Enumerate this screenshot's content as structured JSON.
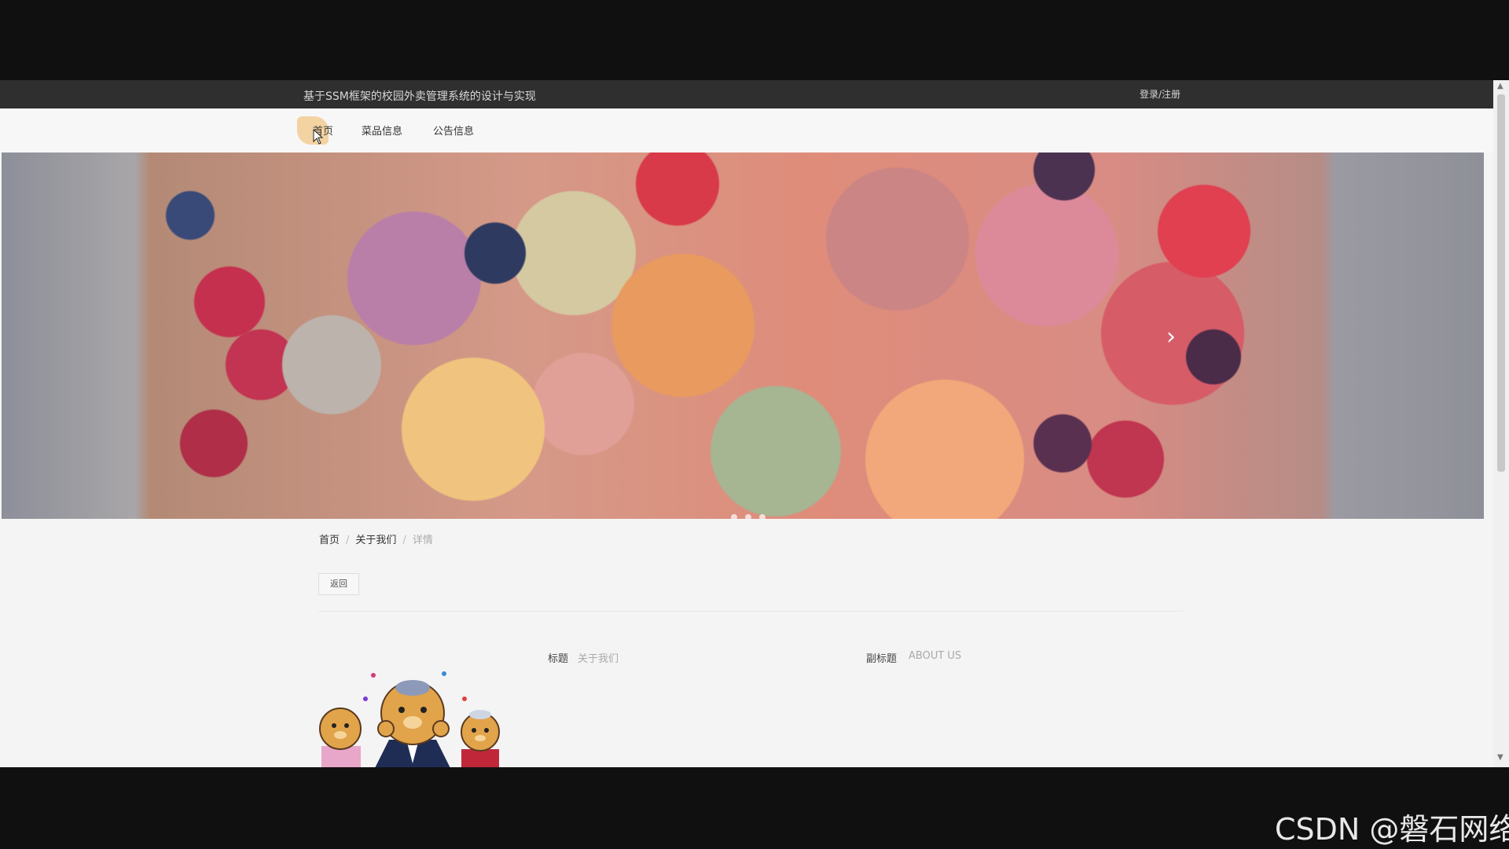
{
  "header": {
    "site_title": "基于SSM框架的校园外卖管理系统的设计与实现",
    "login_label": "登录/注册"
  },
  "nav": {
    "items": [
      {
        "label": "首页"
      },
      {
        "label": "菜品信息"
      },
      {
        "label": "公告信息"
      }
    ]
  },
  "banner": {
    "next_arrow": "›",
    "indicator_count": 3
  },
  "breadcrumb": {
    "home": "首页",
    "section": "关于我们",
    "current": "详情"
  },
  "detail": {
    "back_label": "返回",
    "title_label": "标题",
    "title_value": "关于我们",
    "subtitle_label": "副标题",
    "subtitle_value": "ABOUT US",
    "photo_icon": "cartoon-bears-image"
  },
  "watermark": "CSDN @磐石网络",
  "colors": {
    "topbar": "#2f2f2f",
    "nav_highlight": "#f1c98b",
    "page_bg": "#f4f4f4"
  }
}
